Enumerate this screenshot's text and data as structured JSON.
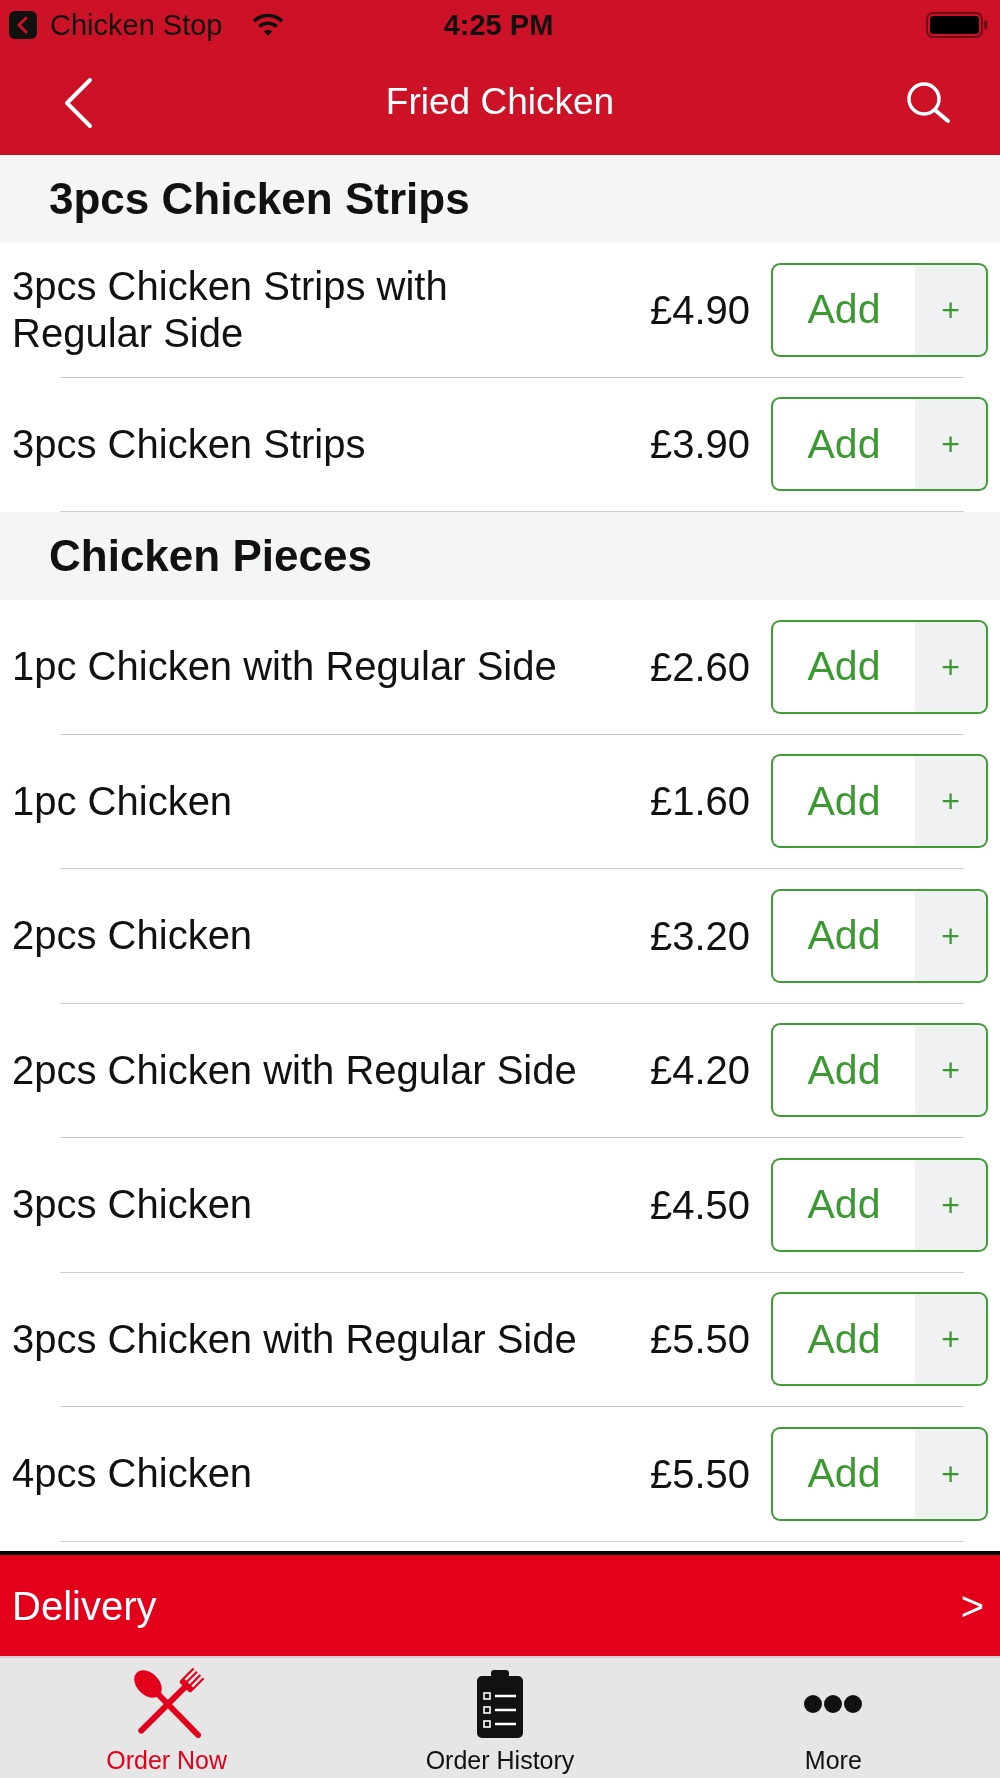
{
  "status_bar": {
    "back_app": "Chicken Stop",
    "time": "4:25 PM"
  },
  "nav": {
    "title": "Fried Chicken"
  },
  "sections": [
    {
      "title": "3pcs Chicken Strips",
      "items": [
        {
          "name": "3pcs Chicken Strips with Regular Side",
          "price": "£4.90",
          "add": "Add",
          "plus": "+"
        },
        {
          "name": "3pcs Chicken Strips",
          "price": "£3.90",
          "add": "Add",
          "plus": "+"
        }
      ]
    },
    {
      "title": "Chicken Pieces",
      "items": [
        {
          "name": "1pc Chicken with Regular Side",
          "price": "£2.60",
          "add": "Add",
          "plus": "+"
        },
        {
          "name": "1pc Chicken",
          "price": "£1.60",
          "add": "Add",
          "plus": "+"
        },
        {
          "name": "2pcs Chicken",
          "price": "£3.20",
          "add": "Add",
          "plus": "+"
        },
        {
          "name": "2pcs Chicken with Regular Side",
          "price": "£4.20",
          "add": "Add",
          "plus": "+"
        },
        {
          "name": "3pcs Chicken",
          "price": "£4.50",
          "add": "Add",
          "plus": "+"
        },
        {
          "name": "3pcs Chicken with Regular Side",
          "price": "£5.50",
          "add": "Add",
          "plus": "+"
        },
        {
          "name": "4pcs Chicken",
          "price": "£5.50",
          "add": "Add",
          "plus": "+"
        }
      ]
    }
  ],
  "delivery": {
    "label": "Delivery",
    "arrow": ">"
  },
  "tabs": [
    {
      "kind": "cutlery",
      "label": "Order Now",
      "selected": true
    },
    {
      "kind": "clipboard",
      "label": "Order History",
      "selected": false
    },
    {
      "kind": "more",
      "label": "More",
      "selected": false
    }
  ]
}
